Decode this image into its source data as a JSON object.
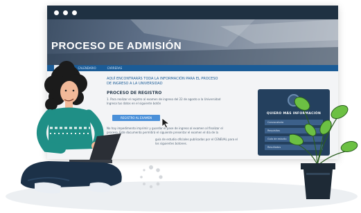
{
  "window": {
    "header_title": "PROCESO DE ADMISIÓN",
    "nav_tabs": [
      "INICIO",
      "CALENDARIO",
      "CARRERAS"
    ]
  },
  "content": {
    "intro_line1": "AQUÍ ENCONTRARÁS TODA LA INFORMACIÓN PARA EL PROCESO",
    "intro_line2": "DE INGRESO A LA UNIVERSIDAD",
    "registro_title": "PROCESO DE REGISTRO",
    "registro_text1": "1. Para realizar el registro al examen de ingreso del 22 de agosto a la Universidad",
    "registro_text2": "Ingresa tus datos en el siguiente botón",
    "register_button": "REGISTRO AL EXAMEN",
    "pase_text1": "No hay impedimento imprimir y guardar el pase de ingreso al examen al finalizar el",
    "pase_text2": "proceso. Este documento permitirá el siguiente presentar el examen el día de la",
    "guia_text1": "guía de estudio oficiales publicadas por el CENEVAL para el",
    "guia_text2": "los siguientes botones."
  },
  "info_panel": {
    "title": "QUIERO MÁS INFORMACIÓN",
    "items": [
      "Convocatoria",
      "Requisitos",
      "Guía de estudio",
      "Resultados"
    ]
  },
  "colors": {
    "titlebar": "#1f3142",
    "navbar": "#1b5c97",
    "panel": "#24405e",
    "button": "#4a90d9",
    "sweater": "#1f8f86",
    "pants": "#1c3148",
    "plant_leaf": "#6cc043"
  },
  "icons": [
    "window-dots-icon",
    "cursor-icon",
    "loading-spinner-icon",
    "university-seal-icon"
  ]
}
